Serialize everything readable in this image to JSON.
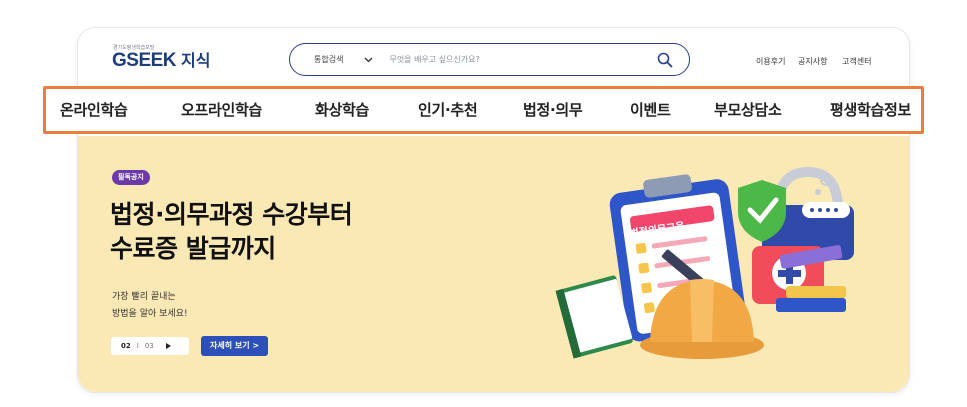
{
  "header": {
    "logo_tagline": "경기도평생학습포털",
    "logo_primary": "GSEEK",
    "logo_secondary": "지식",
    "search": {
      "scope": "통합검색",
      "placeholder": "무엇을 배우고 싶으신가요?"
    },
    "util_links": [
      "이용후기",
      "공지사항",
      "고객센터"
    ]
  },
  "nav": {
    "items": [
      "온라인학습",
      "오프라인학습",
      "화상학습",
      "인기·추천",
      "법정·의무",
      "이벤트",
      "부모상담소",
      "평생학습정보"
    ],
    "highlight_color": "#ec7d3c"
  },
  "banner": {
    "badge": "필독공지",
    "headline_line1": "법정·의무과정 수강부터",
    "headline_line2": "수료증 발급까지",
    "sub_line1": "가장 빨리 끝내는",
    "sub_line2": "방법을 알아 보세요!",
    "pager_current": "02",
    "pager_separator": "I",
    "pager_total": "03",
    "more_button": "자세히 보기 >",
    "illustration_sign": "법정의무교육",
    "background_color": "#fbe9b5"
  },
  "colors": {
    "brand_navy": "#1f3d7a",
    "accent_green": "#4cb848",
    "badge_purple": "#6b3aa8",
    "button_blue": "#2d4fb8"
  }
}
